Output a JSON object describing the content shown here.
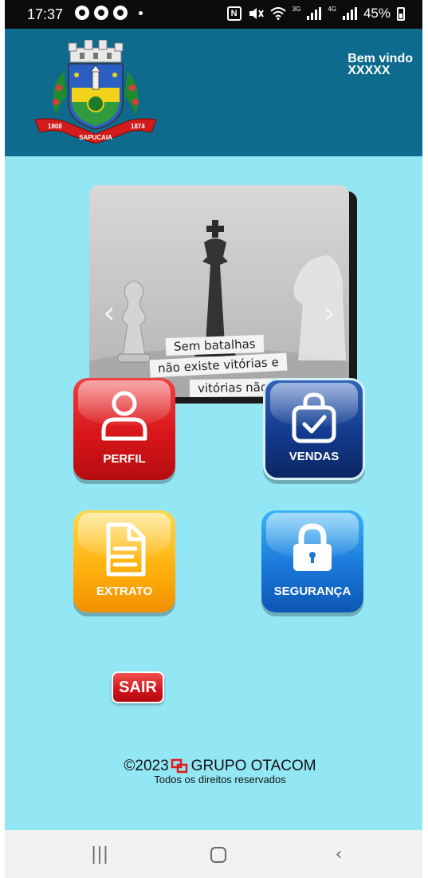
{
  "status_bar": {
    "time": "17:37",
    "network_3g": "3G",
    "network_4g": "4G",
    "battery": "45%"
  },
  "header": {
    "welcome_line1": "Bem vindo",
    "welcome_line2": "XXXXX",
    "crest": {
      "ribbon_left": "1808",
      "ribbon_center": "SAPUCAIA",
      "ribbon_right": "1874"
    },
    "background_color": "#0e6b8e"
  },
  "carousel": {
    "prev_icon": "chevron-left-icon",
    "next_icon": "chevron-right-icon",
    "caption_lines": [
      "Sem batalhas",
      "não existe vitórias e",
      "vitórias não exi"
    ]
  },
  "tiles": {
    "perfil": {
      "label": "PERFIL",
      "icon": "user-icon",
      "color": "#d8161a"
    },
    "vendas": {
      "label": "VENDAS",
      "icon": "shopping-bag-check-icon",
      "color": "#133a8c"
    },
    "extrato": {
      "label": "EXTRATO",
      "icon": "document-icon",
      "color": "#ffb20e"
    },
    "seguranca": {
      "label": "SEGURANÇA",
      "icon": "lock-icon",
      "color": "#1a78d8"
    }
  },
  "logout": {
    "label": "SAIR"
  },
  "footer": {
    "copyright": "©2023",
    "company": "GRUPO OTACOM",
    "rights": "Todos os direitos reservados"
  },
  "nav_bar": {
    "recents": "|||",
    "back": "‹"
  },
  "colors": {
    "page_background": "#93e6f4"
  }
}
